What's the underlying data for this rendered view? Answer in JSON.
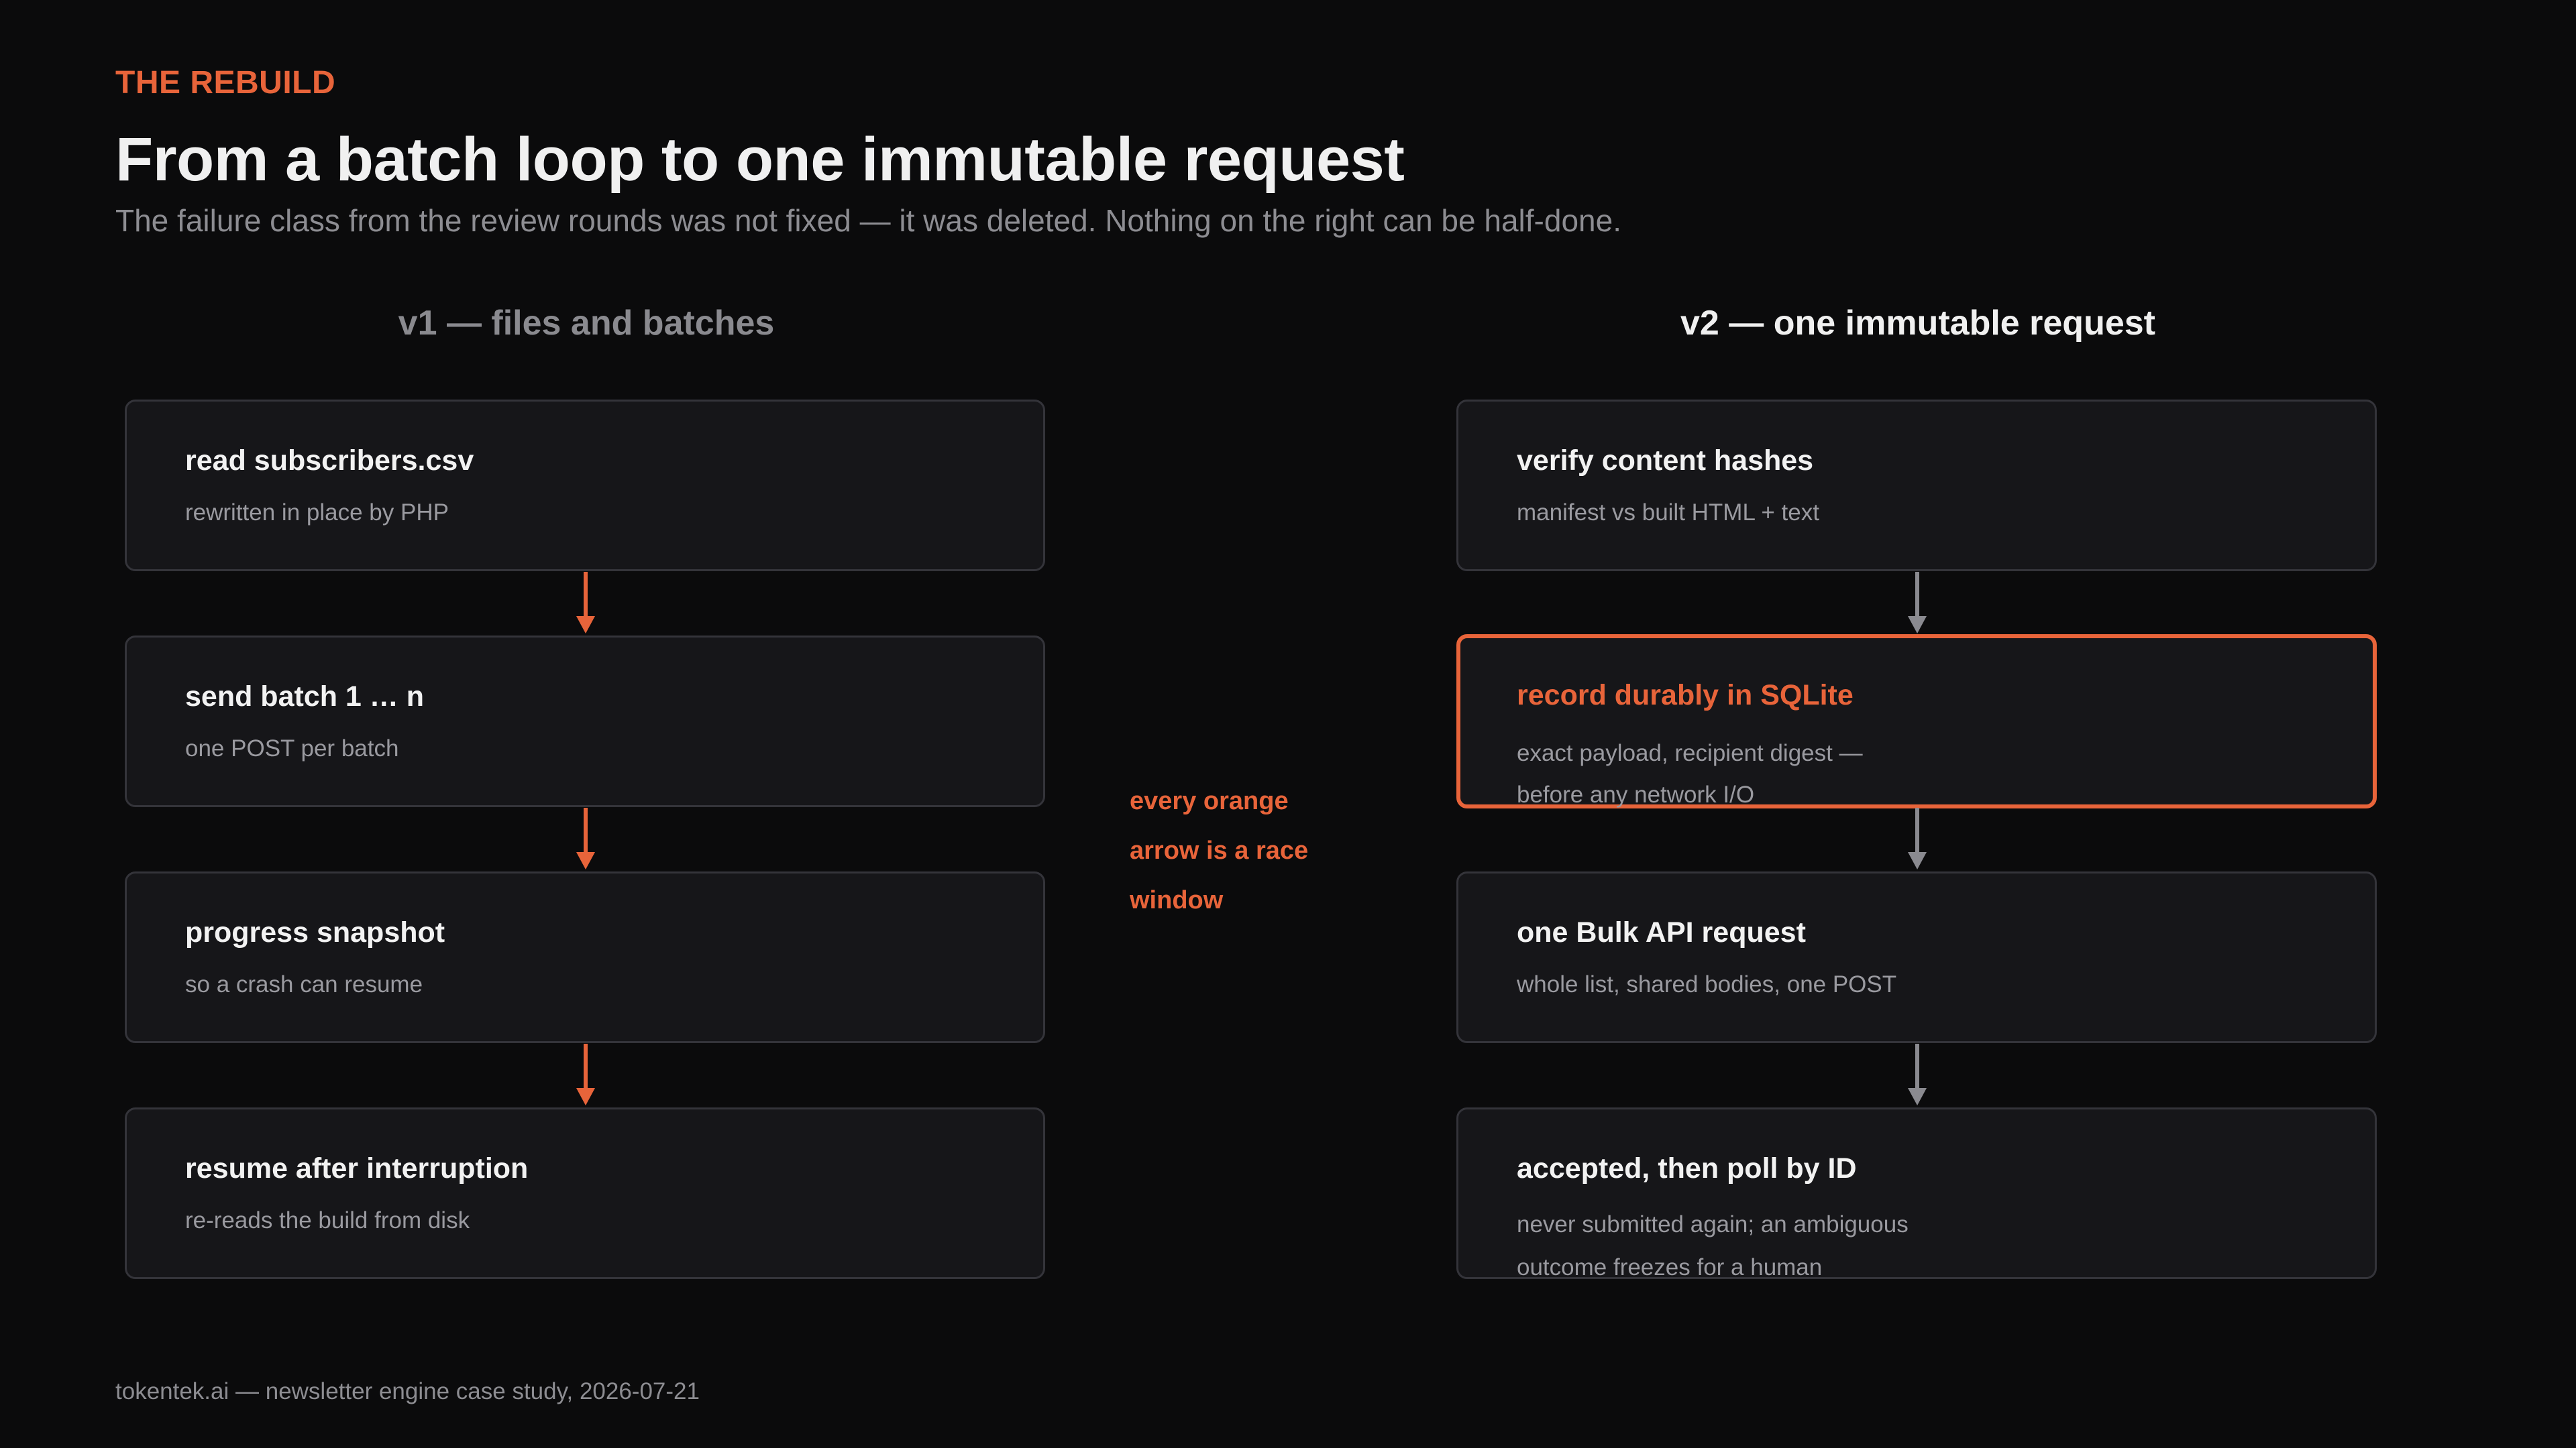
{
  "eyebrow": "THE REBUILD",
  "title": "From a batch loop to one immutable request",
  "subtitle": "The failure class from the review rounds was not fixed — it was deleted. Nothing on the right can be half-done.",
  "colors": {
    "accent": "#e8643a",
    "neutral_arrow": "#8a8a90",
    "box_fill": "#161619",
    "box_border": "#34343a",
    "background": "#0b0b0c"
  },
  "v1": {
    "heading": "v1 — files and batches",
    "steps": [
      {
        "title": "read subscribers.csv",
        "desc": "rewritten in place by PHP"
      },
      {
        "title": "send batch 1 … n",
        "desc": "one POST per batch"
      },
      {
        "title": "progress snapshot",
        "desc": "so a crash can resume"
      },
      {
        "title": "resume after interruption",
        "desc": "re-reads the build from disk"
      }
    ]
  },
  "v2": {
    "heading": "v2 — one immutable request",
    "steps": [
      {
        "title": "verify content hashes",
        "desc": "manifest vs built HTML + text"
      },
      {
        "title": "record durably in SQLite",
        "desc": "exact payload, recipient digest — before any network I/O"
      },
      {
        "title": "one Bulk API request",
        "desc": "whole list, shared bodies, one POST"
      },
      {
        "title": "accepted, then poll by ID",
        "desc": "never submitted again; an ambiguous outcome freezes for a human"
      }
    ]
  },
  "race_note": "every orange arrow is a race window",
  "footer": "tokentek.ai — newsletter engine case study, 2026-07-21"
}
